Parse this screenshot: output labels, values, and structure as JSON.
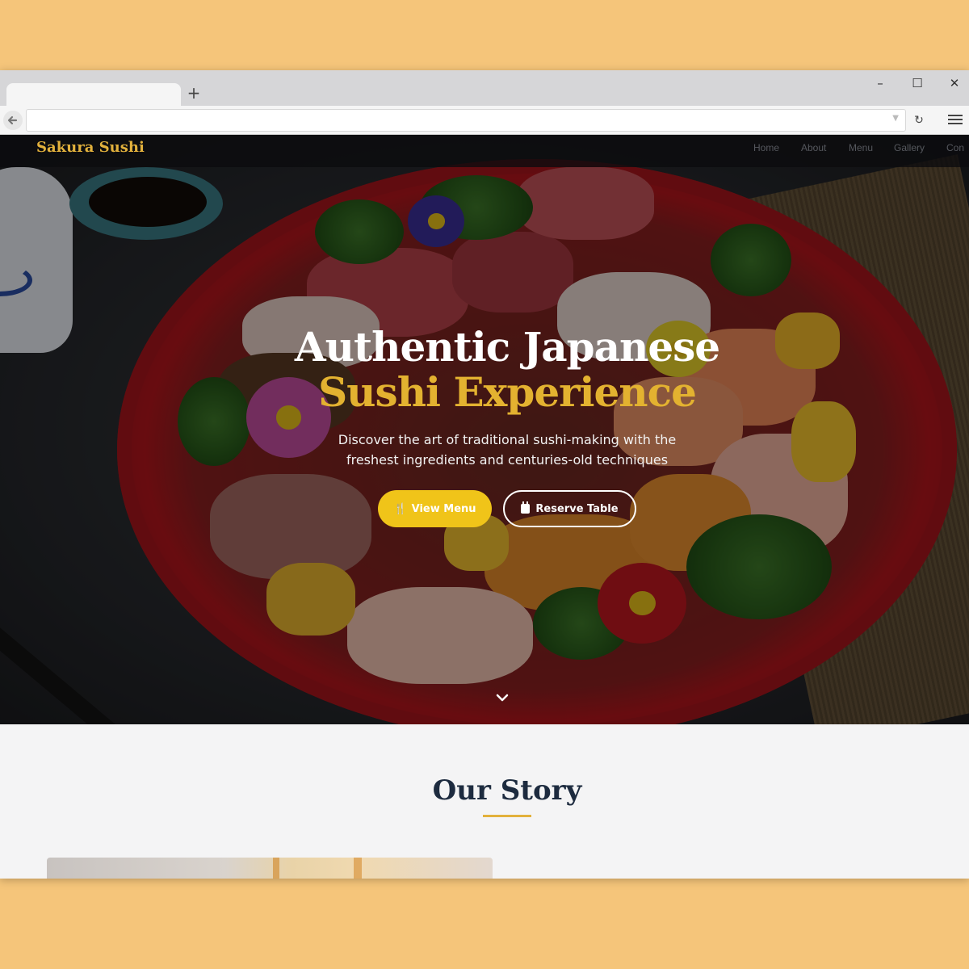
{
  "browser": {
    "new_tab_symbol": "+",
    "window_controls": {
      "minimize": "–",
      "maximize": "☐",
      "close": "✕"
    },
    "back_symbol": "🡐",
    "reload_symbol": "↻",
    "url": ""
  },
  "nav": {
    "brand": "Sakura Sushi",
    "links": [
      "Home",
      "About",
      "Menu",
      "Gallery",
      "Con"
    ]
  },
  "hero": {
    "title_line1": "Authentic Japanese",
    "title_line2": "Sushi Experience",
    "subtitle_line1": "Discover the art of traditional sushi-making with the",
    "subtitle_line2": "freshest ingredients and centuries-old techniques",
    "primary_button": "View Menu",
    "secondary_button": "Reserve Table",
    "fork_icon": "🍴"
  },
  "story": {
    "title": "Our Story"
  },
  "colors": {
    "accent": "#e3b230",
    "button_yellow": "#f0c419",
    "heading_navy": "#1d2b3f",
    "backdrop": "#f5c57a"
  },
  "icons": [
    "fork-knife-icon",
    "calendar-icon",
    "chevron-down-icon",
    "back-arrow-icon",
    "reload-icon",
    "hamburger-menu-icon"
  ]
}
